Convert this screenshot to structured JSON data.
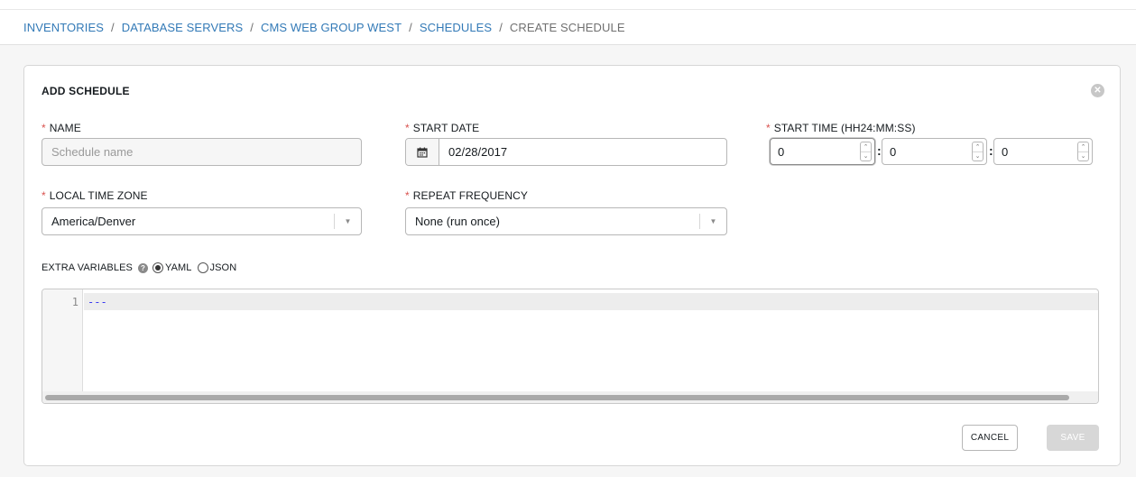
{
  "breadcrumb": {
    "items": [
      "INVENTORIES",
      "DATABASE SERVERS",
      "CMS WEB GROUP WEST",
      "SCHEDULES"
    ],
    "current": "CREATE SCHEDULE",
    "separator": "/"
  },
  "panel": {
    "title": "ADD SCHEDULE",
    "close_icon": "close-circle-icon"
  },
  "form": {
    "required_marker": "*",
    "name": {
      "label": "NAME",
      "value": "",
      "placeholder": "Schedule name"
    },
    "start_date": {
      "label": "START DATE",
      "value": "02/28/2017",
      "icon": "calendar-icon"
    },
    "start_time": {
      "label": "START TIME (HH24:MM:SS)",
      "hour": "0",
      "minute": "0",
      "second": "0",
      "separator": ":"
    },
    "time_zone": {
      "label": "LOCAL TIME ZONE",
      "value": "America/Denver"
    },
    "repeat_frequency": {
      "label": "REPEAT FREQUENCY",
      "value": "None (run once)"
    },
    "extra_variables": {
      "label": "EXTRA VARIABLES",
      "help_icon": "question-circle-icon",
      "options": [
        "YAML",
        "JSON"
      ],
      "selected": "YAML",
      "line_number": "1",
      "code": "---"
    }
  },
  "actions": {
    "cancel": "CANCEL",
    "save": "SAVE"
  },
  "colors": {
    "link": "#337ab7",
    "required": "#d9534f",
    "code": "#3a3af0",
    "save_disabled": "#d7d7d7"
  }
}
